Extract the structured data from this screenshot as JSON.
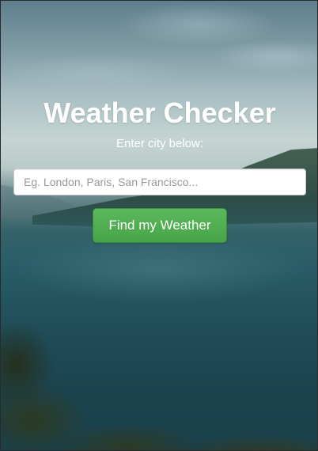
{
  "header": {
    "title": "Weather Checker",
    "subtitle": "Enter city below:"
  },
  "search": {
    "placeholder": "Eg. London, Paris, San Francisco...",
    "value": ""
  },
  "actions": {
    "find_label": "Find my Weather"
  },
  "colors": {
    "button": "#5cb85c",
    "button_border": "#3a8f3a",
    "title_text": "#ffffff"
  }
}
